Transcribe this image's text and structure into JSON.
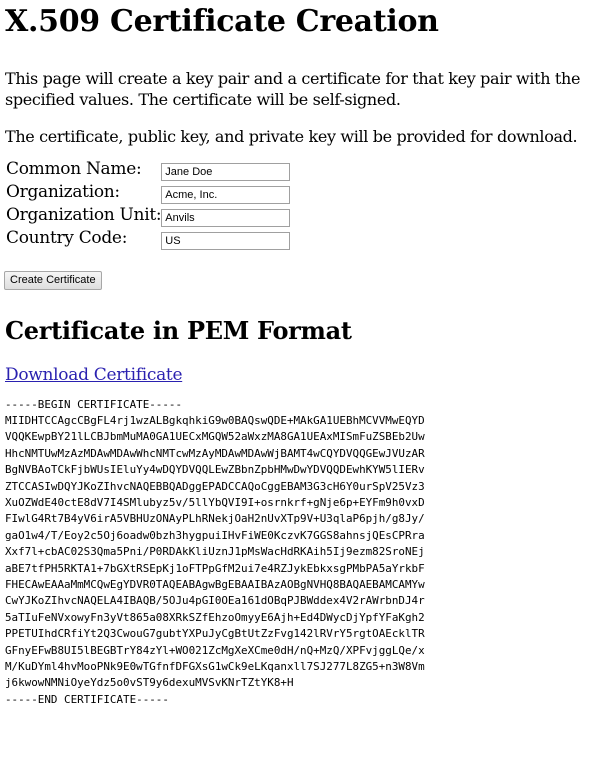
{
  "page": {
    "title": "X.509 Certificate Creation",
    "intro_1": "This page will create a key pair and a certificate for that key pair with the specified values. The certificate will be self-signed.",
    "intro_2": "The certificate, public key, and private key will be provided for download."
  },
  "form": {
    "fields": [
      {
        "label": "Common Name:",
        "value": "Jane Doe"
      },
      {
        "label": "Organization:",
        "value": "Acme, Inc."
      },
      {
        "label": "Organization Unit:",
        "value": "Anvils"
      },
      {
        "label": "Country Code:",
        "value": "US"
      }
    ],
    "submit_label": "Create Certificate"
  },
  "output": {
    "heading": "Certificate in PEM Format",
    "download_link": "Download Certificate",
    "pem_lines": [
      "-----BEGIN CERTIFICATE-----",
      "MIIDHTCCAgcCBgFL4rj1wzALBgkqhkiG9w0BAQswQDE+MAkGA1UEBhMCVVMwEQYD",
      "VQQKEwpBY21lLCBJbmMuMA0GA1UECxMGQW52aWxzMA8GA1UEAxMISmFuZSBEb2Uw",
      "HhcNMTUwMzAzMDAwMDAwWhcNMTcwMzAyMDAwMDAwWjBAMT4wCQYDVQQGEwJVUzAR",
      "BgNVBAoTCkFjbWUsIEluYy4wDQYDVQQLEwZBbnZpbHMwDwYDVQQDEwhKYW5lIERv",
      "ZTCCASIwDQYJKoZIhvcNAQEBBQADggEPADCCAQoCggEBAM3G3cH6Y0urSpV25Vz3",
      "XuOZWdE40ctE8dV7I4SMlubyz5v/5llYbQVI9I+osrnkrf+gNje6p+EYFm9h0vxD",
      "FIwlG4Rt7B4yV6irA5VBHUzONAyPLhRNekjOaH2nUvXTp9V+U3qlaP6pjh/g8Jy/",
      "gaO1w4/T/Eoy2c5Oj6oadw0bzh3hygpuiIHvFiWE0KczvK7GGS8ahnsjQEsCPRra",
      "Xxf7l+cbAC02S3Qma5Pni/P0RDAkKliUznJ1pMsWacHdRKAih5Ij9ezm82SroNEj",
      "aBE7tfPH5RKTA1+7bGXtRSEpKj1oFTPpGfM2ui7e4RZJykEbkxsgPMbPA5aYrkbF",
      "FHECAwEAAaMmMCQwEgYDVR0TAQEABAgwBgEBAAIBAzAOBgNVHQ8BAQAEBAMCAMYw",
      "CwYJKoZIhvcNAQELA4IBAQB/5OJu4pGI0OEa161dOBqPJBWddex4V2rAWrbnDJ4r",
      "5aTIuFeNVxowyFn3yVt865a08XRkSZfEhzoOmyyE6Ajh+Ed4DWycDjYpfYFaKgh2",
      "PPETUIhdCRfiYt2Q3CwouG7gubtYXPuJyCgBtUtZzFvg142lRVrY5rgtOAEcklTR",
      "GFnyEFwB8UI5lBEGBTrY84zYl+WO021ZcMgXeXCme0dH/nQ+MzQ/XPFvjggLQe/x",
      "M/KuDYml4hvMooPNk9E0wTGfnfDFGXsG1wCk9eLKqanxll7SJ277L8ZG5+n3W8Vm",
      "j6kwowNMNiOyeYdz5o0vST9y6dexuMVSvKNrTZtYK8+H",
      "-----END CERTIFICATE-----"
    ]
  }
}
